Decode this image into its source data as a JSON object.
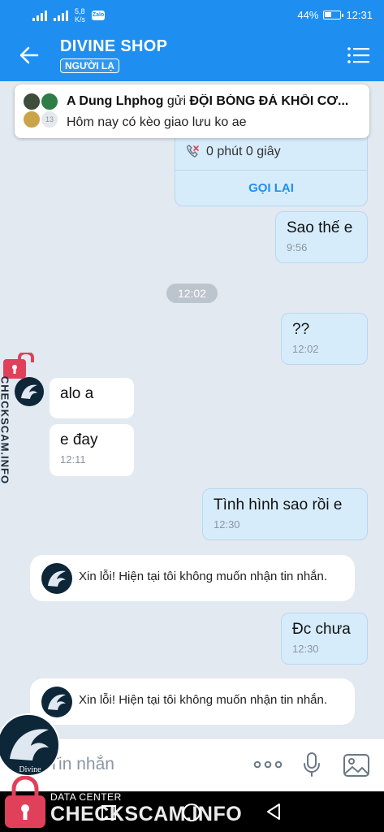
{
  "status_bar": {
    "network_label": "4G",
    "net_speed_value": "5,8",
    "net_speed_unit": "K/s",
    "battery_percent": "44%",
    "time": "12:31",
    "accent": "#1e8ff0"
  },
  "header": {
    "title": "DIVINE SHOP",
    "badge": "NGƯỜI LẠ",
    "back_icon": "arrow-left-icon",
    "menu_icon": "list-menu-icon"
  },
  "pinned": {
    "sender": "A Dung Lhphog",
    "verb": "gửi",
    "group": "ĐỘI BÓNG ĐÁ KHỐI CƠ...",
    "message": "Hôm nay có kèo giao lưu ko ae",
    "extra_count": "13"
  },
  "call_card": {
    "duration": "0 phút 0 giây",
    "action": "GỌI LẠI"
  },
  "messages": [
    {
      "text": "Sao thế e",
      "time": "9:56"
    },
    {
      "separator": "12:02"
    },
    {
      "text": "??",
      "time": "12:02"
    },
    {
      "text": "alo a"
    },
    {
      "text": "e đay",
      "time": "12:11"
    },
    {
      "text": "Tình hình sao rồi e",
      "time": "12:30"
    },
    {
      "system": "Xin lỗi! Hiện tại tôi không muốn nhận tin nhắn."
    },
    {
      "text": "Đc chưa",
      "time": "12:30"
    },
    {
      "system": "Xin lỗi! Hiện tại tôi không muốn nhận tin nhắn."
    }
  ],
  "input": {
    "placeholder": "Tin nhắn"
  },
  "watermark": {
    "site_vertical": "CHECKSCAM.INFO",
    "data_center": "DATA CENTER",
    "site": "CHECKSCAM.INFO",
    "logo_text": "Divine"
  }
}
